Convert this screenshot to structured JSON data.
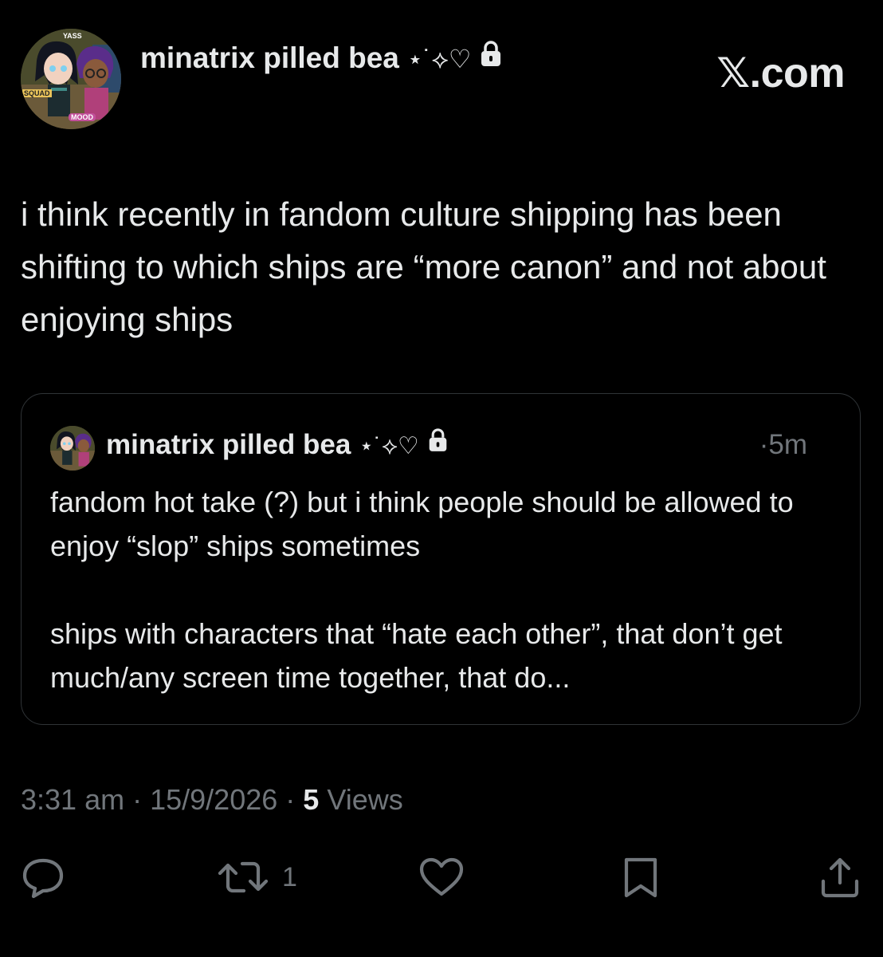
{
  "brand": {
    "label": "𝕏.com"
  },
  "author": {
    "display_name": "minatrix pilled bea",
    "name_decoration": "⋆˙⟡♡",
    "avatar_text": [
      "YASS",
      "SQUAD",
      "MOOD"
    ],
    "icons": [
      "avatar",
      "lock-icon"
    ]
  },
  "tweet": {
    "text": "i think recently in fandom culture shipping has been shifting to which ships are “more canon” and not about enjoying ships"
  },
  "quoted": {
    "display_name": "minatrix pilled bea",
    "name_decoration": "⋆˙⟡♡",
    "separator": "·",
    "time": "5m",
    "text": "fandom hot take (?) but i think people should be allowed to enjoy “slop” ships sometimes\n\nships with characters that “hate each other”, that don’t get much/any screen time together, that do..."
  },
  "meta": {
    "time": "3:31 am",
    "date": "15/9/2026",
    "separator": "·",
    "views_count": "5",
    "views_label": "Views"
  },
  "actions": {
    "reply": {
      "icon": "reply-icon"
    },
    "repost": {
      "icon": "repost-icon",
      "count": "1"
    },
    "like": {
      "icon": "heart-icon"
    },
    "bookmark": {
      "icon": "bookmark-icon"
    },
    "share": {
      "icon": "share-icon"
    }
  },
  "colors": {
    "background": "#000000",
    "text": "#e7e9ea",
    "muted": "#71767b",
    "border": "#2f3336"
  }
}
